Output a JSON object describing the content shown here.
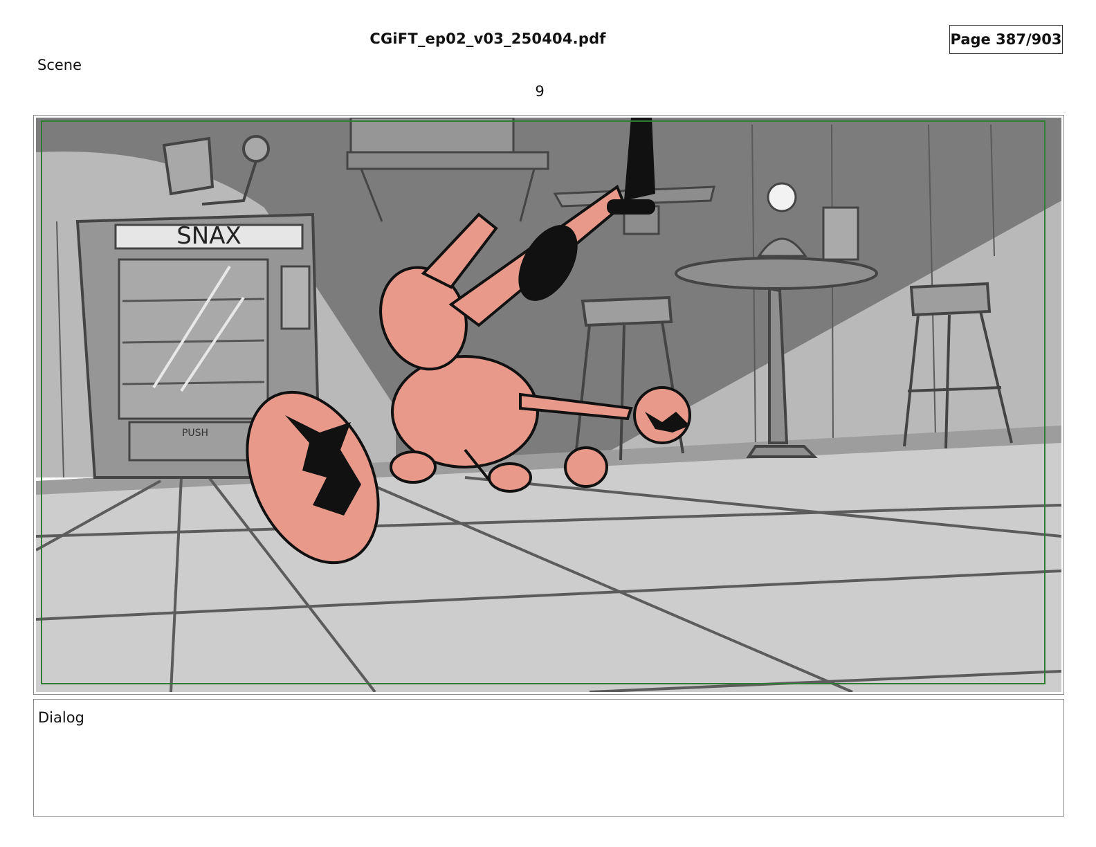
{
  "header": {
    "file_name": "CGiFT_ep02_v03_250404.pdf",
    "page_indicator": "Page 387/903"
  },
  "scene": {
    "label": "Scene",
    "number": "9"
  },
  "panel": {
    "sign_text": "SNAX",
    "push_text": "PUSH",
    "safe_frame_color": "#2e7d32",
    "character_color": "#e8998a"
  },
  "dialog": {
    "label": "Dialog"
  }
}
